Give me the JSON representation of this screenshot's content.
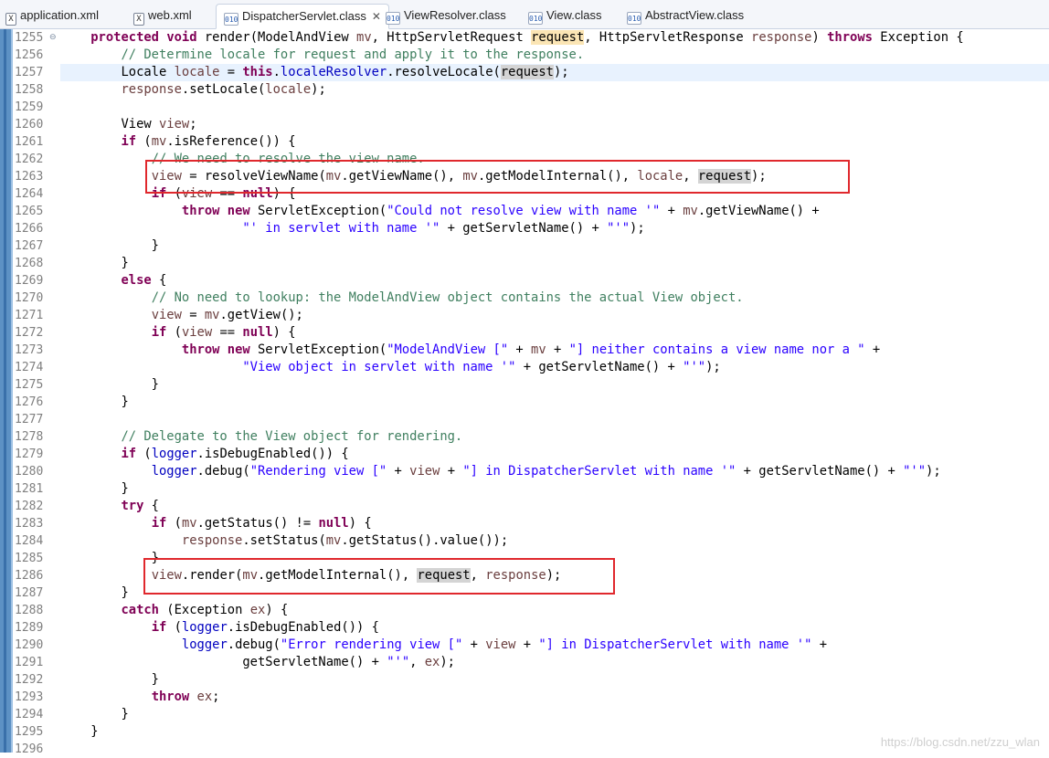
{
  "tabs": [
    {
      "label": "application.xml",
      "icon": "xml-file-icon",
      "glyph": "X"
    },
    {
      "label": "web.xml",
      "icon": "xml-file-icon",
      "glyph": "X"
    },
    {
      "label": "DispatcherServlet.class",
      "icon": "class-file-icon",
      "glyph": "010",
      "active": true,
      "close": "✕"
    },
    {
      "label": "ViewResolver.class",
      "icon": "class-file-icon",
      "glyph": "010"
    },
    {
      "label": "View.class",
      "icon": "class-file-icon",
      "glyph": "010"
    },
    {
      "label": "AbstractView.class",
      "icon": "class-file-icon",
      "glyph": "010"
    }
  ],
  "line_numbers": [
    "1255",
    "1256",
    "1257",
    "1258",
    "1259",
    "1260",
    "1261",
    "1262",
    "1263",
    "1264",
    "1265",
    "1266",
    "1267",
    "1268",
    "1269",
    "1270",
    "1271",
    "1272",
    "1273",
    "1274",
    "1275",
    "1276",
    "1277",
    "1278",
    "1279",
    "1280",
    "1281",
    "1282",
    "1283",
    "1284",
    "1285",
    "1286",
    "1287",
    "1288",
    "1289",
    "1290",
    "1291",
    "1292",
    "1293",
    "1294",
    "1295",
    "1296"
  ],
  "code_lines": [
    "    protected void render(ModelAndView mv, HttpServletRequest request, HttpServletResponse response) throws Exception {",
    "        // Determine locale for request and apply it to the response.",
    "        Locale locale = this.localeResolver.resolveLocale(request);",
    "        response.setLocale(locale);",
    "",
    "        View view;",
    "        if (mv.isReference()) {",
    "            // We need to resolve the view name.",
    "            view = resolveViewName(mv.getViewName(), mv.getModelInternal(), locale, request);",
    "            if (view == null) {",
    "                throw new ServletException(\"Could not resolve view with name '\" + mv.getViewName() +",
    "                        \"' in servlet with name '\" + getServletName() + \"'\");",
    "            }",
    "        }",
    "        else {",
    "            // No need to lookup: the ModelAndView object contains the actual View object.",
    "            view = mv.getView();",
    "            if (view == null) {",
    "                throw new ServletException(\"ModelAndView [\" + mv + \"] neither contains a view name nor a \" +",
    "                        \"View object in servlet with name '\" + getServletName() + \"'\");",
    "            }",
    "        }",
    "",
    "        // Delegate to the View object for rendering.",
    "        if (logger.isDebugEnabled()) {",
    "            logger.debug(\"Rendering view [\" + view + \"] in DispatcherServlet with name '\" + getServletName() + \"'\");",
    "        }",
    "        try {",
    "            if (mv.getStatus() != null) {",
    "                response.setStatus(mv.getStatus().value());",
    "            }",
    "            view.render(mv.getModelInternal(), request, response);",
    "        }",
    "        catch (Exception ex) {",
    "            if (logger.isDebugEnabled()) {",
    "                logger.debug(\"Error rendering view [\" + view + \"] in DispatcherServlet with name '\" + ",
    "                        getServletName() + \"'\", ex);",
    "            }",
    "            throw ex;",
    "        }",
    "    }",
    ""
  ],
  "watermark": "https://blog.csdn.net/zzu_wlan",
  "colors": {
    "keyword": "#7f0055",
    "comment": "#3f7f5f",
    "string": "#2a00ff",
    "field": "#0000c0",
    "highlight_box": "#e0282d",
    "current_line": "#e8f2fe"
  }
}
